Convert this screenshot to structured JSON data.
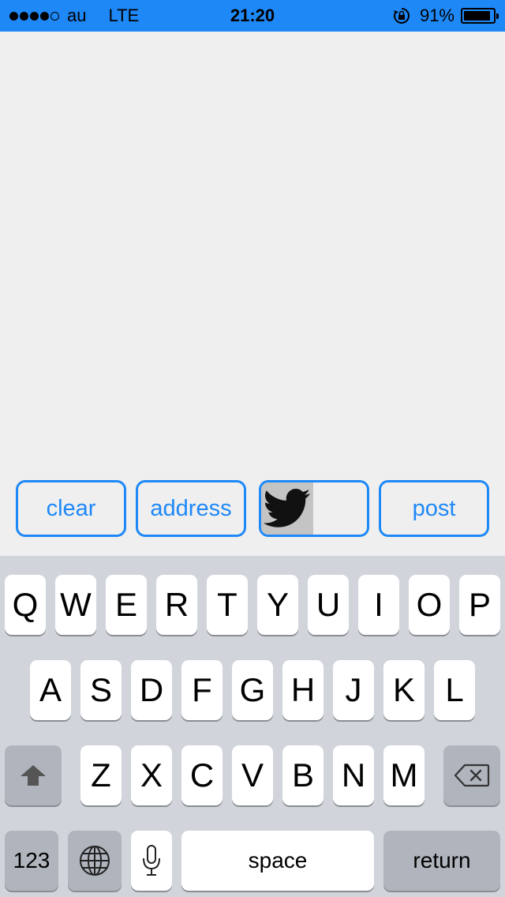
{
  "status_bar": {
    "signal_dots": [
      true,
      true,
      true,
      true,
      false
    ],
    "carrier": "au",
    "network": "LTE",
    "time": "21:20",
    "battery_percent": "91%",
    "battery_level": 0.91,
    "bar_color": "#1e88f7"
  },
  "actions": {
    "clear_label": "clear",
    "address_label": "address",
    "twitter_icon": "twitter-bird-icon",
    "post_label": "post",
    "accent_color": "#1e88f7"
  },
  "keyboard": {
    "row1": [
      "Q",
      "W",
      "E",
      "R",
      "T",
      "Y",
      "U",
      "I",
      "O",
      "P"
    ],
    "row2": [
      "A",
      "S",
      "D",
      "F",
      "G",
      "H",
      "J",
      "K",
      "L"
    ],
    "row3": [
      "Z",
      "X",
      "C",
      "V",
      "B",
      "N",
      "M"
    ],
    "shift_icon": "shift-arrow-icon",
    "delete_icon": "backspace-icon",
    "numbers_label": "123",
    "globe_icon": "globe-icon",
    "mic_icon": "microphone-icon",
    "space_label": "space",
    "return_label": "return"
  }
}
